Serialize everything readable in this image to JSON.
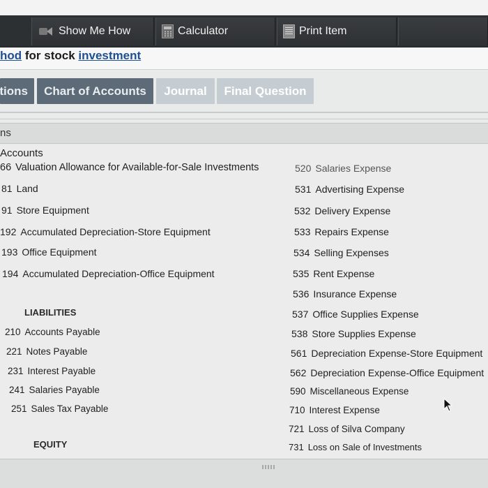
{
  "toolbar": {
    "show_me_how": "Show Me How",
    "calculator": "Calculator",
    "print_item": "Print Item"
  },
  "title": {
    "part1": "hod",
    "part2": " for stock ",
    "part3": "investment"
  },
  "tabs": [
    {
      "label": "tions",
      "style": "dark"
    },
    {
      "label": "Chart of Accounts",
      "style": "dark"
    },
    {
      "label": "Journal",
      "style": "light"
    },
    {
      "label": "Final Question",
      "style": "light"
    }
  ],
  "section_header": "ns",
  "panel_title": "Accounts",
  "left_column": {
    "accounts": [
      {
        "num": "66",
        "name": "Valuation Allowance for Available-for-Sale Investments"
      },
      {
        "num": "81",
        "name": "Land"
      },
      {
        "num": "91",
        "name": "Store Equipment"
      },
      {
        "num": "192",
        "name": "Accumulated Depreciation-Store Equipment"
      },
      {
        "num": "193",
        "name": "Office Equipment"
      },
      {
        "num": "194",
        "name": "Accumulated Depreciation-Office Equipment"
      }
    ],
    "liabilities_header": "LIABILITIES",
    "liabilities": [
      {
        "num": "210",
        "name": "Accounts Payable"
      },
      {
        "num": "221",
        "name": "Notes Payable"
      },
      {
        "num": "231",
        "name": "Interest Payable"
      },
      {
        "num": "241",
        "name": "Salaries Payable"
      },
      {
        "num": "251",
        "name": "Sales Tax Payable"
      }
    ],
    "equity_header": "EQUITY"
  },
  "right_column": {
    "accounts": [
      {
        "num": "520",
        "name": "Salaries Expense"
      },
      {
        "num": "531",
        "name": "Advertising Expense"
      },
      {
        "num": "532",
        "name": "Delivery Expense"
      },
      {
        "num": "533",
        "name": "Repairs Expense"
      },
      {
        "num": "534",
        "name": "Selling Expenses"
      },
      {
        "num": "535",
        "name": "Rent Expense"
      },
      {
        "num": "536",
        "name": "Insurance Expense"
      },
      {
        "num": "537",
        "name": "Office Supplies Expense"
      },
      {
        "num": "538",
        "name": "Store Supplies Expense"
      },
      {
        "num": "561",
        "name": "Depreciation Expense-Store Equipment"
      },
      {
        "num": "562",
        "name": "Depreciation Expense-Office Equipment"
      },
      {
        "num": "590",
        "name": "Miscellaneous Expense"
      },
      {
        "num": "710",
        "name": "Interest Expense"
      },
      {
        "num": "721",
        "name": "Loss of Silva Company"
      },
      {
        "num": "731",
        "name": "Loss on Sale of Investments"
      }
    ]
  }
}
